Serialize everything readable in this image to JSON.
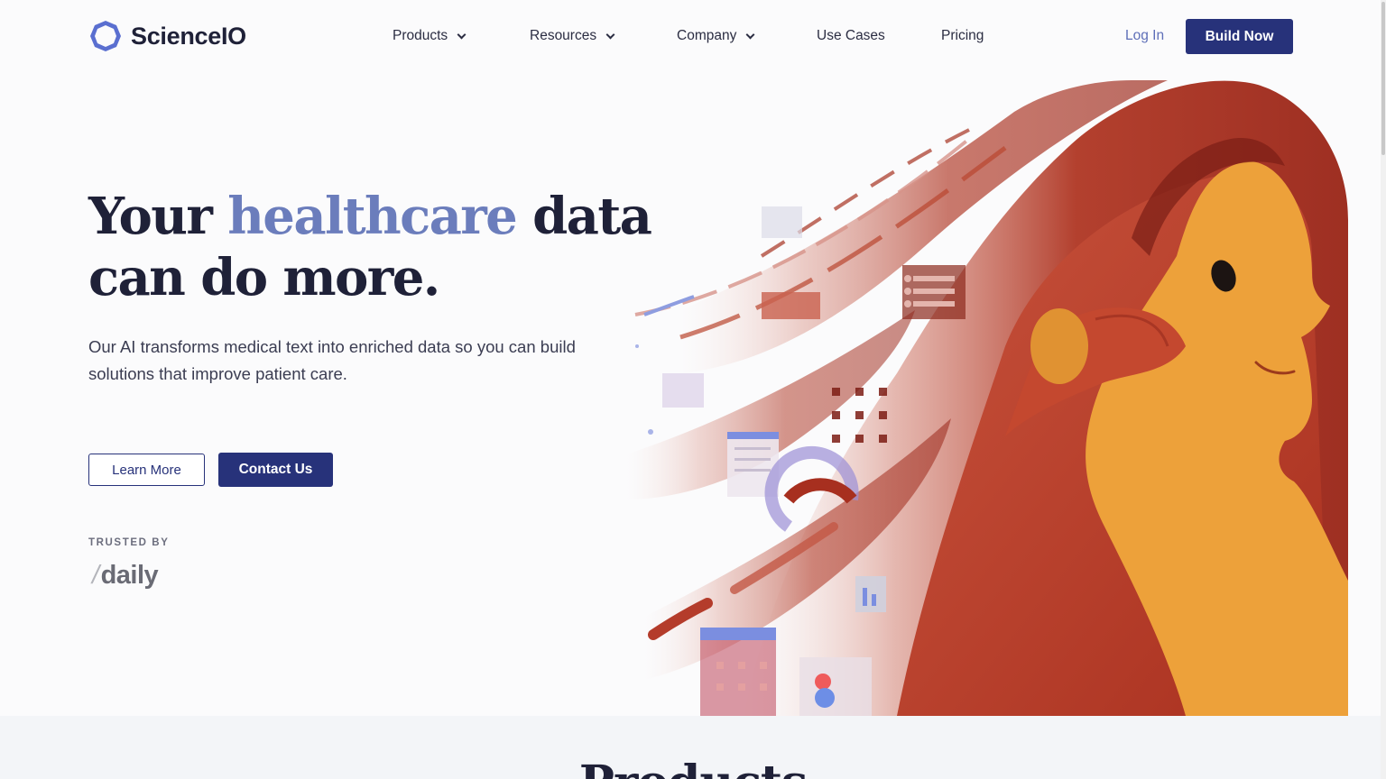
{
  "header": {
    "logo_text": "ScienceIO",
    "nav": [
      {
        "label": "Products"
      },
      {
        "label": "Resources"
      },
      {
        "label": "Company"
      },
      {
        "label": "Use Cases"
      },
      {
        "label": "Pricing"
      }
    ],
    "login_label": "Log In",
    "cta_label": "Build Now"
  },
  "hero": {
    "title_part1": "Your ",
    "title_accent": "healthcare",
    "title_part2": " data can do more.",
    "subtitle": "Our AI transforms medical text into enriched data so you can build solutions that improve patient care.",
    "learn_more_label": "Learn More",
    "contact_label": "Contact Us",
    "trusted_by_label": "TRUSTED BY",
    "trusted_logo_slash": "/",
    "trusted_logo_text": "daily"
  },
  "products_section": {
    "title": "Products"
  },
  "colors": {
    "brand_navy": "#27327a",
    "accent_blue": "#6b7dbc",
    "text_dark": "#1f2138",
    "hair_red": "#b73c2a",
    "face_orange": "#eda13a"
  }
}
